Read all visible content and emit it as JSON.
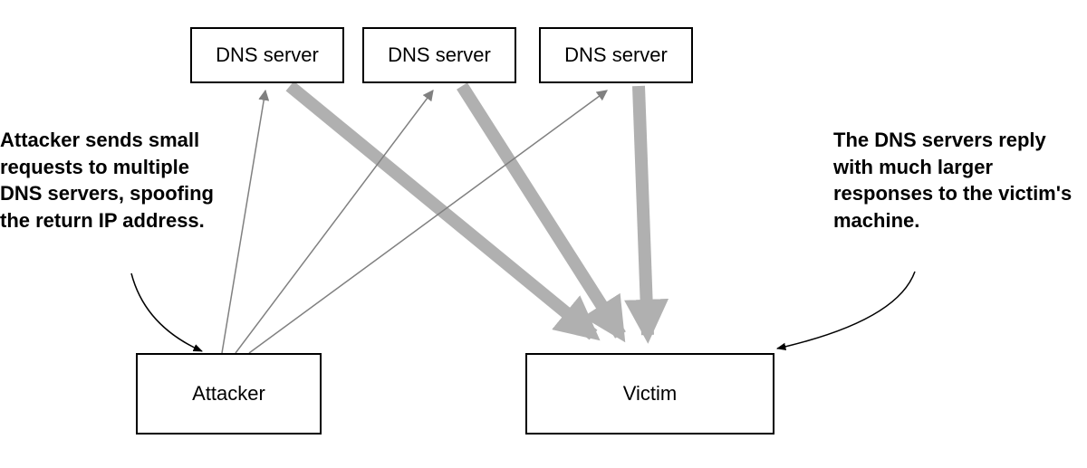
{
  "diagram": {
    "type": "dns-amplification-attack",
    "nodes": {
      "dns_servers": [
        {
          "id": "dns1",
          "label": "DNS server"
        },
        {
          "id": "dns2",
          "label": "DNS server"
        },
        {
          "id": "dns3",
          "label": "DNS server"
        }
      ],
      "attacker": {
        "label": "Attacker"
      },
      "victim": {
        "label": "Victim"
      }
    },
    "annotations": {
      "left": "Attacker sends small requests to multiple DNS servers, spoofing the return IP address.",
      "right": "The DNS servers reply with much larger responses to the victim's machine."
    },
    "edges": {
      "requests": [
        {
          "from": "attacker",
          "to": "dns1",
          "size": "small"
        },
        {
          "from": "attacker",
          "to": "dns2",
          "size": "small"
        },
        {
          "from": "attacker",
          "to": "dns3",
          "size": "small"
        }
      ],
      "responses": [
        {
          "from": "dns1",
          "to": "victim",
          "size": "large"
        },
        {
          "from": "dns2",
          "to": "victim",
          "size": "large"
        },
        {
          "from": "dns3",
          "to": "victim",
          "size": "large"
        }
      ]
    },
    "colors": {
      "node_border": "#000000",
      "request_arrow": "#808080",
      "response_arrow": "#b0b0b0",
      "text": "#000000",
      "background": "#ffffff"
    }
  }
}
